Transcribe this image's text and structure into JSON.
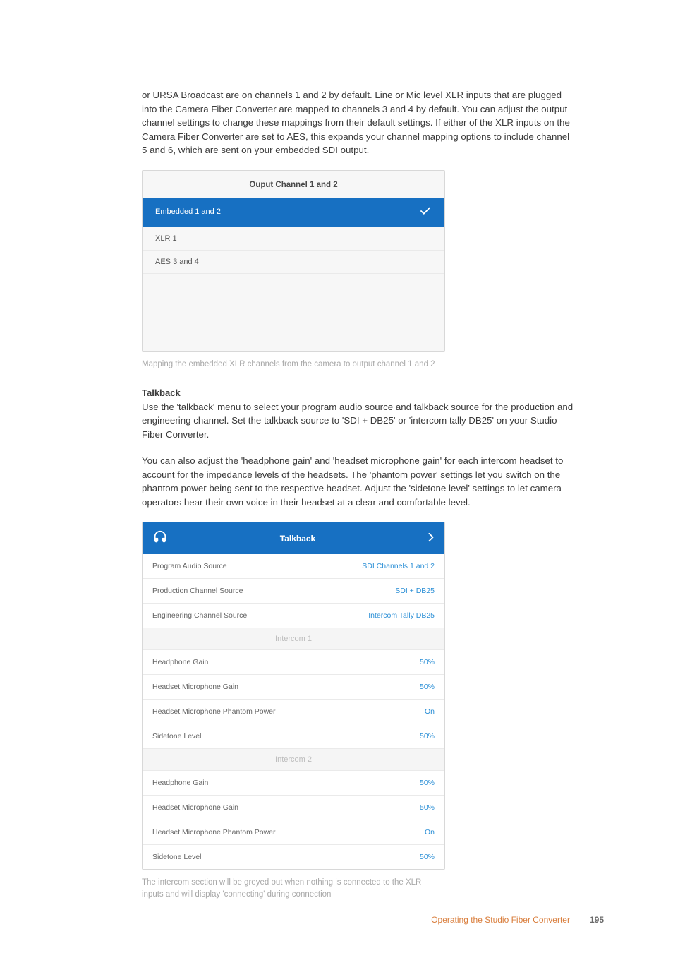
{
  "paragraph1": "or URSA Broadcast are on channels 1 and 2 by default. Line or Mic level XLR inputs that are plugged into the Camera Fiber Converter are mapped to channels 3 and 4 by default. You can adjust the output channel settings to change these mappings from their default settings. If either of the XLR inputs on the Camera Fiber Converter are set to AES, this expands your channel mapping options to include channel 5 and 6, which are sent on your embedded SDI output.",
  "panel1": {
    "header": "Ouput Channel 1 and 2",
    "rows": [
      {
        "label": "Embedded 1 and 2",
        "selected": true
      },
      {
        "label": "XLR 1",
        "selected": false
      },
      {
        "label": "AES 3 and 4",
        "selected": false
      }
    ]
  },
  "caption1": "Mapping the embedded XLR channels from the camera to output channel 1 and 2",
  "subheading": "Talkback",
  "paragraph2": "Use the 'talkback' menu to select your program audio source and talkback source for the production and engineering channel. Set the talkback source to 'SDI + DB25' or 'intercom tally DB25' on your Studio Fiber Converter.",
  "paragraph3": "You can also adjust the 'headphone gain' and 'headset microphone gain' for each intercom headset to account for the impedance levels of the headsets. The 'phantom power' settings let you switch on the phantom power being sent to the respective headset. Adjust the 'sidetone level' settings to let camera operators hear their own voice in their headset at a clear and comfortable level.",
  "talkback": {
    "title": "Talkback",
    "top_rows": [
      {
        "label": "Program Audio Source",
        "value": "SDI Channels 1 and 2"
      },
      {
        "label": "Production Channel Source",
        "value": "SDI + DB25"
      },
      {
        "label": "Engineering Channel Source",
        "value": "Intercom Tally DB25"
      }
    ],
    "intercom1_label": "Intercom 1",
    "intercom1_rows": [
      {
        "label": "Headphone Gain",
        "value": "50%"
      },
      {
        "label": "Headset Microphone Gain",
        "value": "50%"
      },
      {
        "label": "Headset Microphone Phantom Power",
        "value": "On"
      },
      {
        "label": "Sidetone Level",
        "value": "50%"
      }
    ],
    "intercom2_label": "Intercom 2",
    "intercom2_rows": [
      {
        "label": "Headphone Gain",
        "value": "50%"
      },
      {
        "label": "Headset Microphone Gain",
        "value": "50%"
      },
      {
        "label": "Headset Microphone Phantom Power",
        "value": "On"
      },
      {
        "label": "Sidetone Level",
        "value": "50%"
      }
    ]
  },
  "caption2": "The intercom section will be greyed out when nothing is connected to the XLR inputs and will display 'connecting' during connection",
  "footer": {
    "title": "Operating the Studio Fiber Converter",
    "page": "195"
  }
}
